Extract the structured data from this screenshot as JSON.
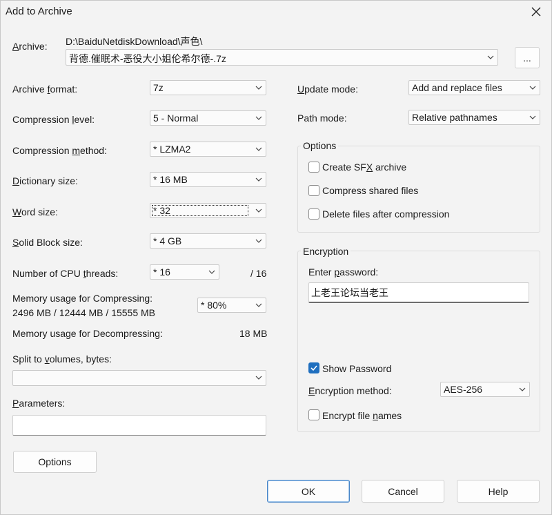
{
  "window": {
    "title": "Add to Archive"
  },
  "archive": {
    "label": "Archive:",
    "path": "D:\\BaiduNetdiskDownload\\声色\\",
    "filename": "背德.催眠术-恶役大小姐伦希尔德-.7z",
    "browse_label": "..."
  },
  "left": {
    "format": {
      "label": "Archive format:",
      "value": "7z"
    },
    "level": {
      "label": "Compression level:",
      "value": "5 - Normal"
    },
    "method": {
      "label": "Compression method:",
      "value": "*  LZMA2"
    },
    "dict": {
      "label": "Dictionary size:",
      "value": "*  16 MB"
    },
    "word": {
      "label": "Word size:",
      "value": "*  32"
    },
    "solid": {
      "label": "Solid Block size:",
      "value": "*  4 GB"
    },
    "threads": {
      "label": "Number of CPU threads:",
      "value": "*  16",
      "max": "/ 16"
    },
    "mem_comp": {
      "label": "Memory usage for Compressing:",
      "detail": "2496 MB / 12444 MB / 15555 MB",
      "value": "*  80%"
    },
    "mem_decomp": {
      "label": "Memory usage for Decompressing:",
      "value": "18 MB"
    },
    "split": {
      "label": "Split to volumes, bytes:",
      "value": ""
    },
    "params": {
      "label": "Parameters:",
      "value": ""
    },
    "options_button": "Options"
  },
  "right": {
    "update": {
      "label": "Update mode:",
      "value": "Add and replace files"
    },
    "path": {
      "label": "Path mode:",
      "value": "Relative pathnames"
    },
    "options": {
      "title": "Options",
      "sfx": "Create SFX archive",
      "shared": "Compress shared files",
      "delete": "Delete files after compression"
    },
    "encryption": {
      "title": "Encryption",
      "password_label": "Enter password:",
      "password": "上老王论坛当老王",
      "show_password": "Show Password",
      "method_label": "Encryption method:",
      "method_value": "AES-256",
      "encrypt_names": "Encrypt file names"
    }
  },
  "buttons": {
    "ok": "OK",
    "cancel": "Cancel",
    "help": "Help"
  }
}
